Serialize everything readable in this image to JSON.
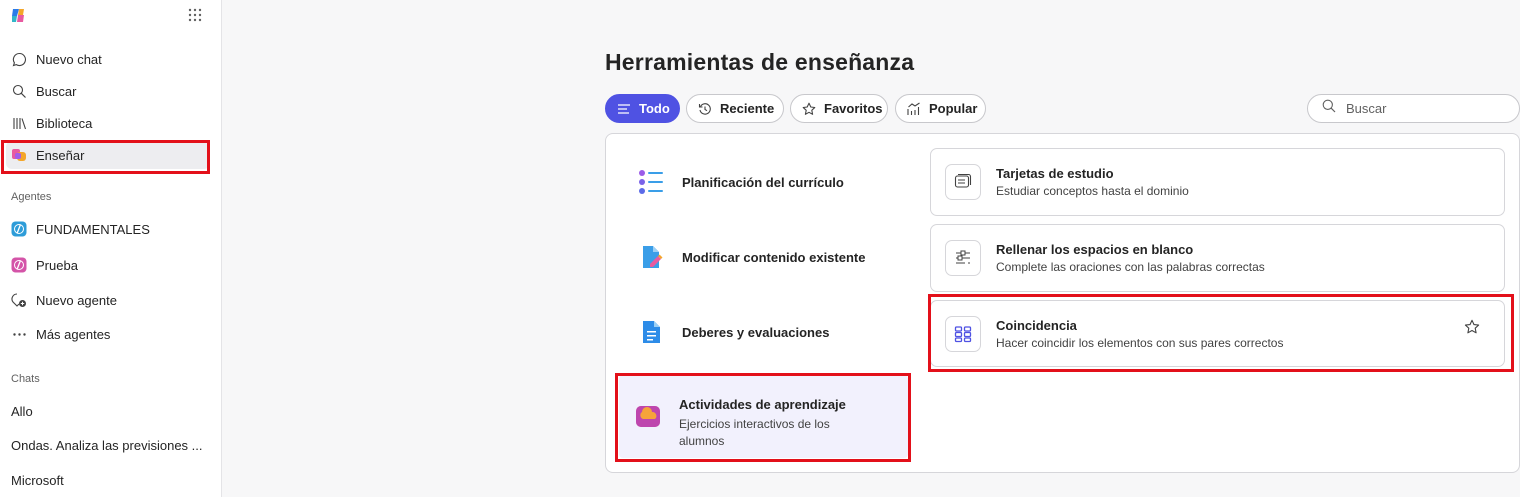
{
  "sidebar": {
    "nav": [
      {
        "label": "Nuevo chat",
        "icon": "chat-icon"
      },
      {
        "label": "Buscar",
        "icon": "search-icon"
      },
      {
        "label": "Biblioteca",
        "icon": "library-icon"
      },
      {
        "label": "Enseñar",
        "icon": "teach-icon"
      }
    ],
    "agents_heading": "Agentes",
    "agents": [
      {
        "label": "FUNDAMENTALES",
        "icon": "agent-icon"
      },
      {
        "label": "Prueba",
        "icon": "agent-icon"
      },
      {
        "label": "Nuevo agente",
        "icon": "new-agent-icon"
      },
      {
        "label": "Más agentes",
        "icon": "more-icon"
      }
    ],
    "chats_heading": "Chats",
    "chats": [
      "Allo",
      "Ondas. Analiza las previsiones ...",
      "Microsoft"
    ]
  },
  "main": {
    "title": "Herramientas de enseñanza",
    "filters": [
      "Todo",
      "Reciente",
      "Favoritos",
      "Popular"
    ],
    "search_placeholder": "Buscar",
    "categories": [
      {
        "label": "Planificación del currículo"
      },
      {
        "label": "Modificar contenido existente"
      },
      {
        "label": "Deberes y evaluaciones"
      },
      {
        "label": "Actividades de aprendizaje",
        "desc": "Ejercicios interactivos de los alumnos"
      }
    ],
    "cards": [
      {
        "title": "Tarjetas de estudio",
        "desc": "Estudiar conceptos hasta el dominio"
      },
      {
        "title": "Rellenar los espacios en blanco",
        "desc": "Complete las oraciones con las palabras correctas"
      },
      {
        "title": "Coincidencia",
        "desc": "Hacer coincidir los elementos con sus pares correctos"
      }
    ]
  },
  "colors": {
    "accent": "#4f52e3",
    "highlight": "#e3101a"
  }
}
